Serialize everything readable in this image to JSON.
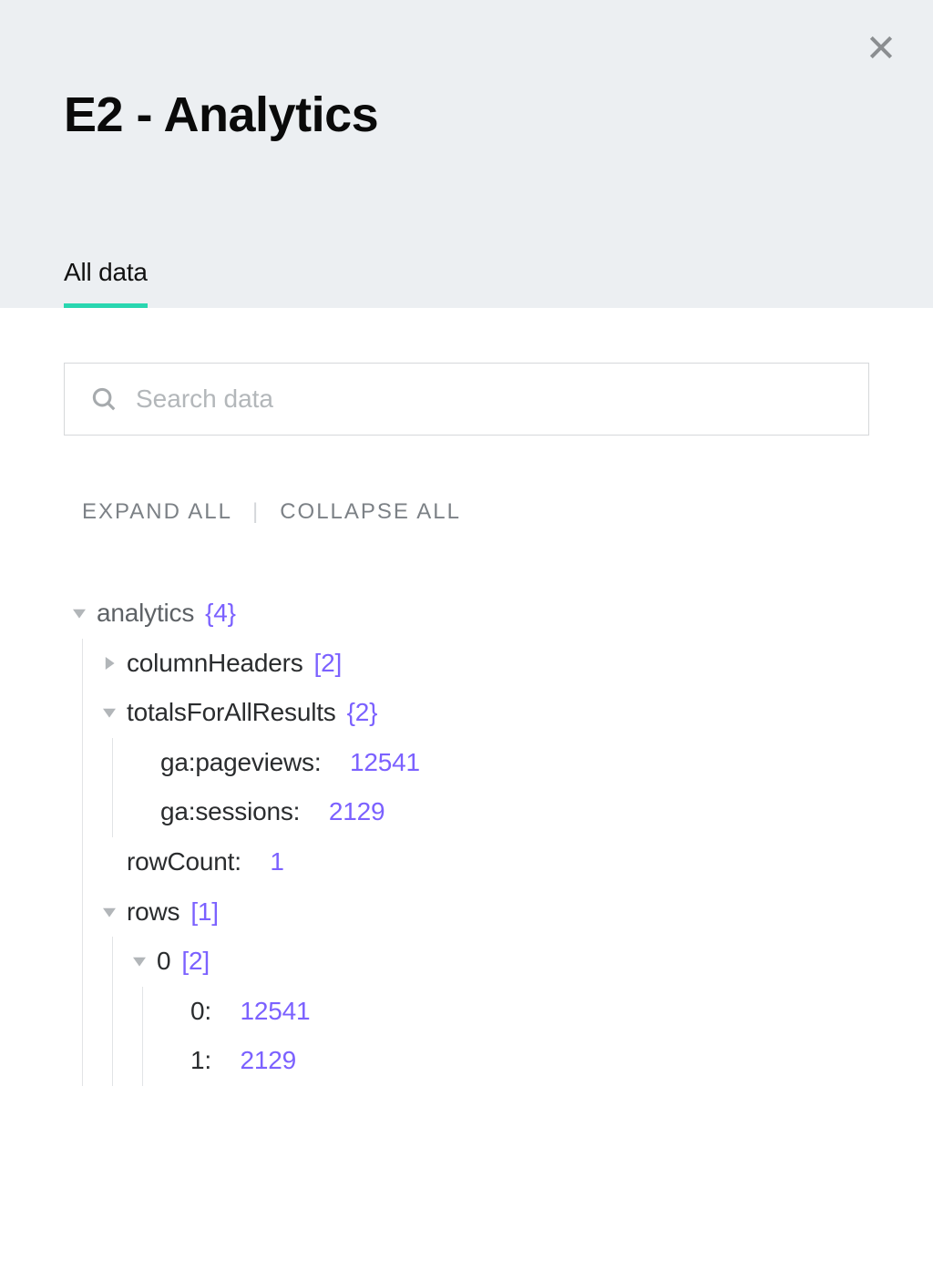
{
  "header": {
    "title": "E2 - Analytics"
  },
  "tabs": {
    "all_data": "All data"
  },
  "search": {
    "placeholder": "Search data"
  },
  "controls": {
    "expand": "EXPAND ALL",
    "collapse": "COLLAPSE ALL"
  },
  "tree": {
    "analytics": {
      "label": "analytics",
      "count": "{4}",
      "columnHeaders": {
        "label": "columnHeaders",
        "count": "[2]"
      },
      "totalsForAllResults": {
        "label": "totalsForAllResults",
        "count": "{2}",
        "pageviews_key": "ga:pageviews:",
        "pageviews_val": "12541",
        "sessions_key": "ga:sessions:",
        "sessions_val": "2129"
      },
      "rowCount": {
        "label": "rowCount:",
        "value": "1"
      },
      "rows": {
        "label": "rows",
        "count": "[1]",
        "item0": {
          "label": "0",
          "count": "[2]",
          "k0": "0:",
          "v0": "12541",
          "k1": "1:",
          "v1": "2129"
        }
      }
    }
  }
}
